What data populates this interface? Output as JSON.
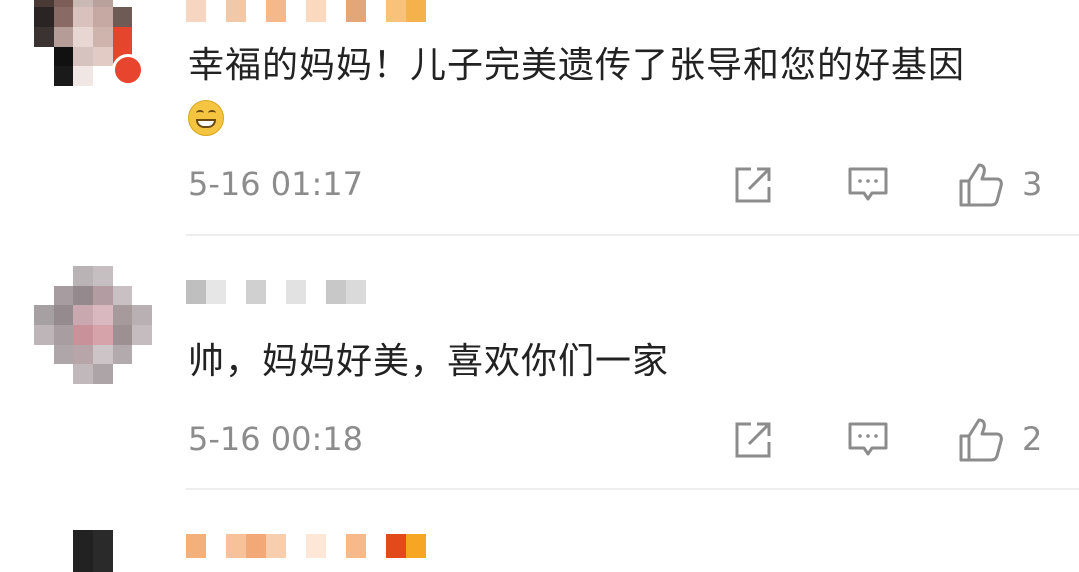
{
  "comments": [
    {
      "text": "幸福的妈妈！儿子完美遗传了张导和您的好基因",
      "emoji": "grinning-face",
      "time": "5-16 01:17",
      "likes": "3",
      "avatar_colors": [
        "#d8cfcc",
        "#a99d9a",
        "#9a8a86",
        "#e4d3cf",
        "#ffffff",
        "#ffffff",
        "#4a3a36",
        "#7d5d57",
        "#c9b8b3",
        "#b8a09b",
        "#ffffff",
        "#ffffff",
        "#2a2424",
        "#8a6a64",
        "#d9c2bd",
        "#c7a9a3",
        "#6e5b56",
        "#ffffff",
        "#3b3331",
        "#b59c97",
        "#e8d6d2",
        "#cfb3ad",
        "#e5452d",
        "#ffffff",
        "#ffffff",
        "#111111",
        "#d6c3bf",
        "#e2cac5",
        "#e8452f",
        "#ffffff",
        "#ffffff",
        "#1a1a1a",
        "#f0e6e4",
        "#ffffff",
        "#ffffff",
        "#ffffff"
      ],
      "name_colors": [
        "#f6d6c0",
        "#ffffff",
        "#f2c9a8",
        "#ffffff",
        "#f5b88a",
        "#ffffff",
        "#fbd9bf",
        "#ffffff",
        "#e3a678",
        "#ffffff",
        "#f9c27a",
        "#f5b14c"
      ]
    },
    {
      "text": "帅，妈妈好美，喜欢你们一家",
      "time": "5-16 00:18",
      "likes": "2",
      "avatar_colors": [
        "#ffffff",
        "#ffffff",
        "#b9b3b5",
        "#c6bfc1",
        "#ffffff",
        "#ffffff",
        "#ffffff",
        "#a79da0",
        "#948a8d",
        "#b39ca2",
        "#c8c0c3",
        "#ffffff",
        "#a7a0a2",
        "#958a8e",
        "#c9a9af",
        "#d9b9bf",
        "#a69a9d",
        "#b8b0b3",
        "#bdb5b8",
        "#a89ea1",
        "#c99199",
        "#d7a3aa",
        "#9c9093",
        "#c4bcbf",
        "#ffffff",
        "#aea6a9",
        "#b8a5a9",
        "#ccc4c6",
        "#b2aaad",
        "#ffffff",
        "#ffffff",
        "#ffffff",
        "#c0b8bb",
        "#aca4a7",
        "#ffffff",
        "#ffffff"
      ],
      "name_colors": [
        "#bfbfbf",
        "#e6e6e6",
        "#ffffff",
        "#d0d0d0",
        "#ffffff",
        "#e2e2e2",
        "#ffffff",
        "#c8c8c8",
        "#dadada"
      ]
    },
    {
      "avatar_colors": [
        "#ffffff",
        "#ffffff",
        "#222",
        "#2a2a2a",
        "#ffffff",
        "#ffffff"
      ],
      "name_colors": [
        "#f4b07a",
        "#ffffff",
        "#f7c19a",
        "#f3a878",
        "#f8cfae",
        "#ffffff",
        "#fde7d6",
        "#ffffff",
        "#f8b98a",
        "#ffffff",
        "#e24a1c",
        "#f6a623"
      ]
    }
  ]
}
